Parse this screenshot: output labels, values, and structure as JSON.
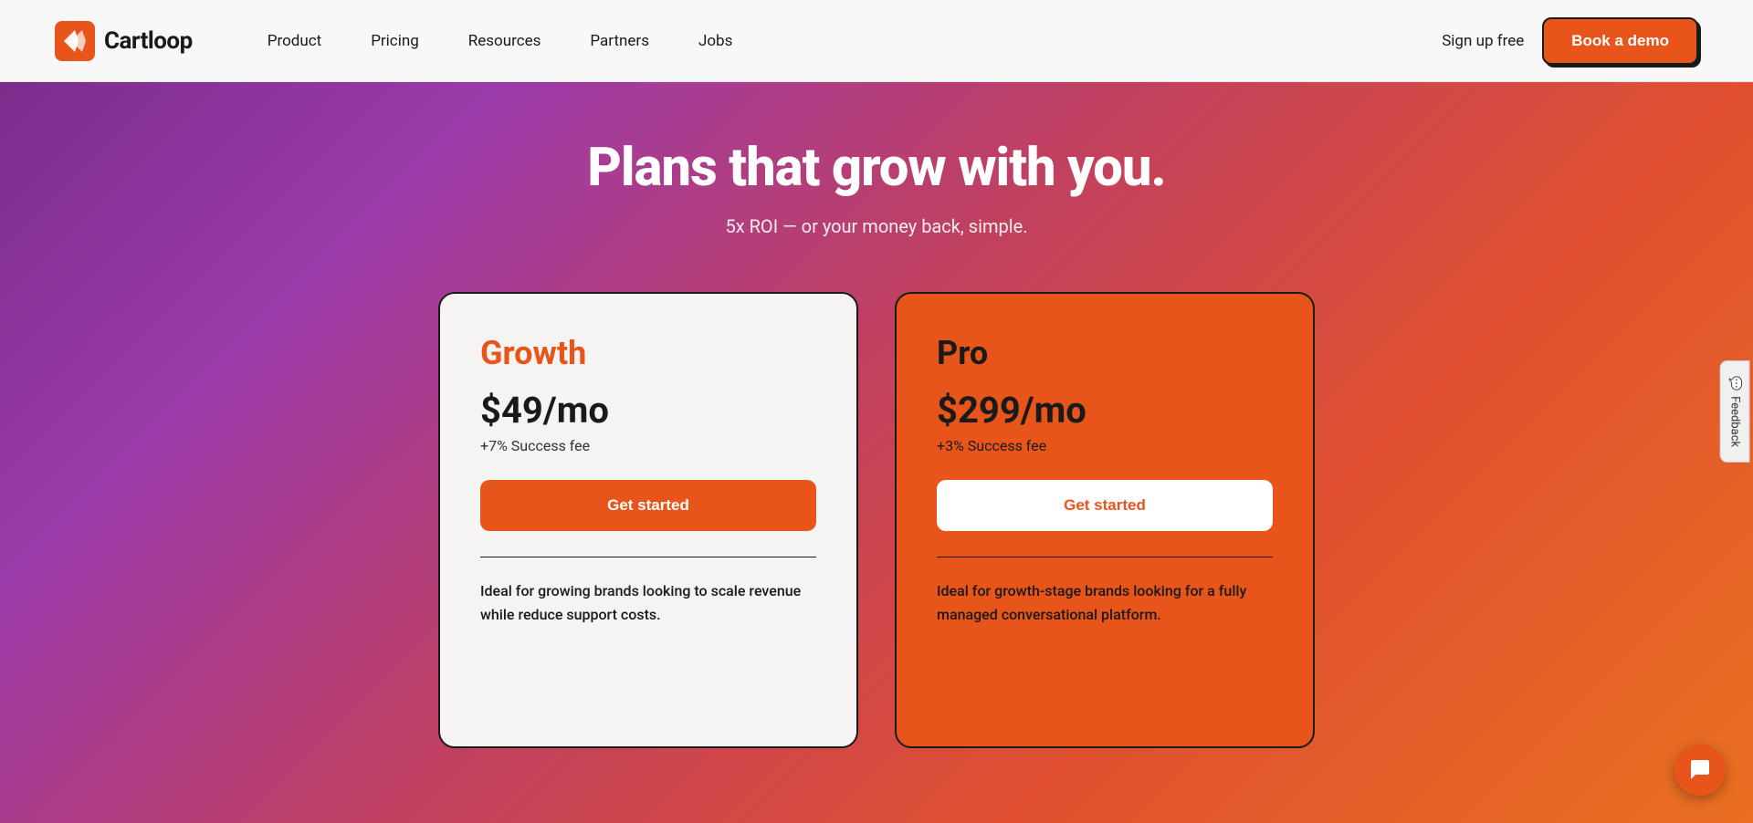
{
  "navbar": {
    "logo_text": "Cartloop",
    "nav_links": [
      {
        "label": "Product",
        "id": "product"
      },
      {
        "label": "Pricing",
        "id": "pricing"
      },
      {
        "label": "Resources",
        "id": "resources"
      },
      {
        "label": "Partners",
        "id": "partners"
      },
      {
        "label": "Jobs",
        "id": "jobs"
      }
    ],
    "sign_up_label": "Sign up free",
    "book_demo_label": "Book a demo"
  },
  "hero": {
    "title": "Plans that grow with you.",
    "subtitle": "5x ROI — or your money back, simple."
  },
  "cards": [
    {
      "id": "growth",
      "plan_name": "Growth",
      "price": "$49/mo",
      "fee": "+7% Success fee",
      "cta": "Get started",
      "description": "Ideal for growing brands looking to scale revenue while reduce support costs."
    },
    {
      "id": "pro",
      "plan_name": "Pro",
      "price": "$299/mo",
      "fee": "+3% Success fee",
      "cta": "Get started",
      "description": "Ideal for growth-stage brands looking for a fully managed conversational platform."
    }
  ],
  "feedback": {
    "label": "Feedback",
    "icon": "💬"
  },
  "chat": {
    "icon": "💬"
  }
}
